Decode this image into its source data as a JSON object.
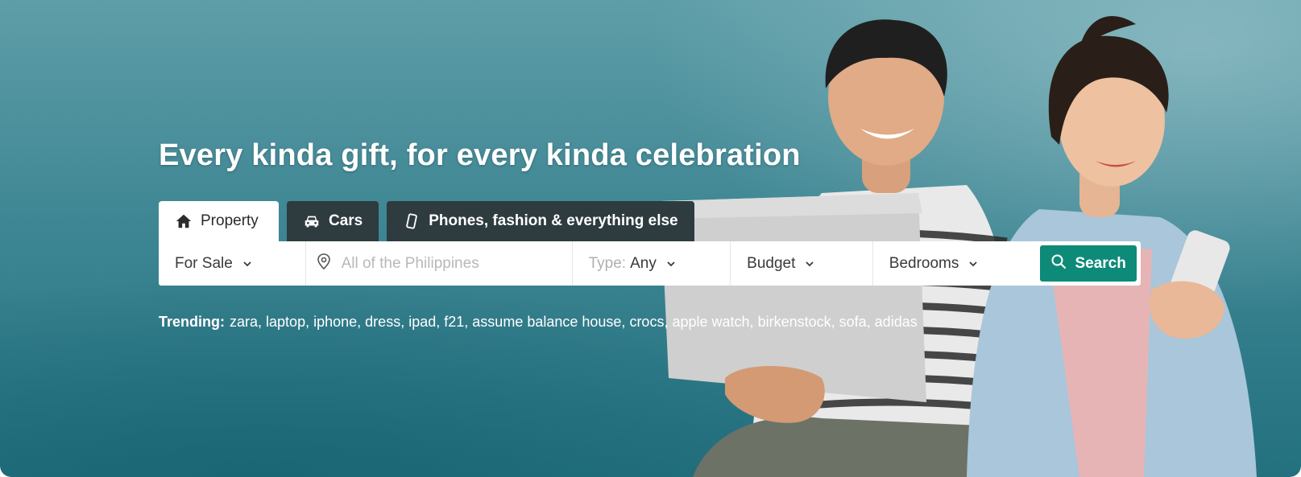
{
  "hero": {
    "headline": "Every kinda gift, for every kinda celebration"
  },
  "tabs": [
    {
      "label": "Property",
      "icon": "home-icon",
      "active": true
    },
    {
      "label": "Cars",
      "icon": "car-icon",
      "active": false
    },
    {
      "label": "Phones, fashion & everything else",
      "icon": "phone-icon",
      "active": false
    }
  ],
  "search": {
    "listing_type": "For Sale",
    "location_placeholder": "All of the Philippines",
    "type_label": "Type:",
    "type_value": "Any",
    "budget": "Budget",
    "bedrooms": "Bedrooms",
    "button_label": "Search"
  },
  "trending": {
    "label": "Trending:",
    "terms": [
      "zara",
      "laptop",
      "iphone",
      "dress",
      "ipad",
      "f21",
      "assume balance house",
      "crocs",
      "apple watch",
      "birkenstock",
      "sofa",
      "adidas"
    ]
  },
  "colors": {
    "accent": "#0e8b78",
    "tab_dark": "#2e3b3f",
    "background": "#3f8794"
  }
}
